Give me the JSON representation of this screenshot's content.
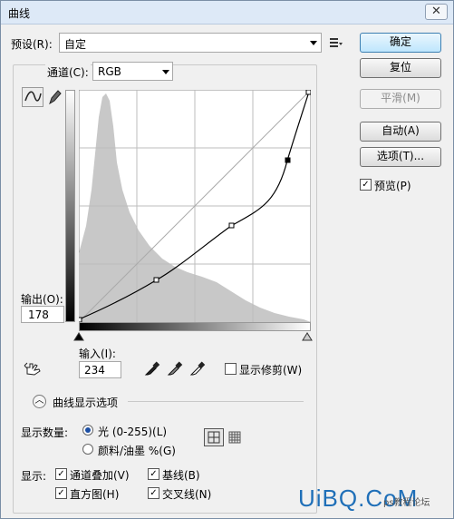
{
  "window": {
    "title": "曲线",
    "close_glyph": "✕"
  },
  "preset": {
    "label": "预设(R):",
    "value": "自定",
    "menu_icon": "list-settings-icon"
  },
  "buttons": {
    "ok": "确定",
    "reset": "复位",
    "smooth": "平滑(M)",
    "auto": "自动(A)",
    "options": "选项(T)..."
  },
  "preview": {
    "label": "预览(P)",
    "checked": true
  },
  "channel": {
    "label": "通道(C):",
    "value": "RGB"
  },
  "output": {
    "label": "输出(O):",
    "value": "178"
  },
  "input": {
    "label": "输入(I):",
    "value": "234"
  },
  "clipping": {
    "label": "显示修剪(W)",
    "checked": false
  },
  "curve_options": {
    "label": "曲线显示选项"
  },
  "amount": {
    "label": "显示数量:",
    "options": [
      {
        "label": "光 (0-255)(L)",
        "selected": true
      },
      {
        "label": "颜料/油墨 %(G)",
        "selected": false
      }
    ]
  },
  "show": {
    "label": "显示:",
    "items": [
      {
        "label": "通道叠加(V)",
        "checked": true
      },
      {
        "label": "基线(B)",
        "checked": true
      },
      {
        "label": "直方图(H)",
        "checked": true
      },
      {
        "label": "交叉线(N)",
        "checked": true
      }
    ]
  },
  "watermark": {
    "main": "UiBQ.CoM",
    "sub": "ps教程论坛"
  },
  "colors": {
    "accent": "#1c4fa4",
    "histogram": "#c8c8c8",
    "watermark": "#1f6fb8"
  }
}
